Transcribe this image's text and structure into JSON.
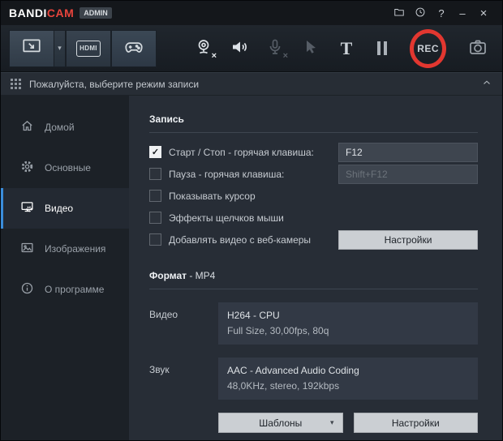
{
  "titlebar": {
    "brand_left": "BANDI",
    "brand_right": "CAM",
    "admin": "ADMIN",
    "help": "?",
    "minimize": "–",
    "close": "×"
  },
  "icons": {
    "x": "×",
    "check": "✓",
    "dropdown": "▾"
  },
  "toolbar": {
    "rec": "REC",
    "hdmi": "HDMI",
    "text_tool": "T"
  },
  "banner": {
    "text": "Пожалуйста, выберите режим записи"
  },
  "sidebar": {
    "items": [
      {
        "label": "Домой"
      },
      {
        "label": "Основные"
      },
      {
        "label": "Видео"
      },
      {
        "label": "Изображения"
      },
      {
        "label": "О программе"
      }
    ]
  },
  "record": {
    "title": "Запись",
    "rows": [
      {
        "label": "Старт / Стоп - горячая клавиша:",
        "value": "F12",
        "checked": true
      },
      {
        "label": "Пауза - горячая клавиша:",
        "value": "Shift+F12",
        "checked": false
      },
      {
        "label": "Показывать курсор",
        "checked": false
      },
      {
        "label": "Эффекты щелчков мыши",
        "checked": false
      },
      {
        "label": "Добавлять видео с веб-камеры",
        "checked": false,
        "button": "Настройки"
      }
    ]
  },
  "format": {
    "title": "Формат",
    "subtitle": " - MP4",
    "video_label": "Видео",
    "video": {
      "line1": "H264 - CPU",
      "line2": "Full Size, 30,00fps, 80q"
    },
    "audio_label": "Звук",
    "audio": {
      "line1": "AAC - Advanced Audio Coding",
      "line2": "48,0KHz, stereo, 192kbps"
    },
    "templates_button": "Шаблоны",
    "settings_button": "Настройки"
  },
  "colors": {
    "accent_red": "#e8443c",
    "accent_blue": "#3a8ddb",
    "rec_ring": "#e23730"
  }
}
